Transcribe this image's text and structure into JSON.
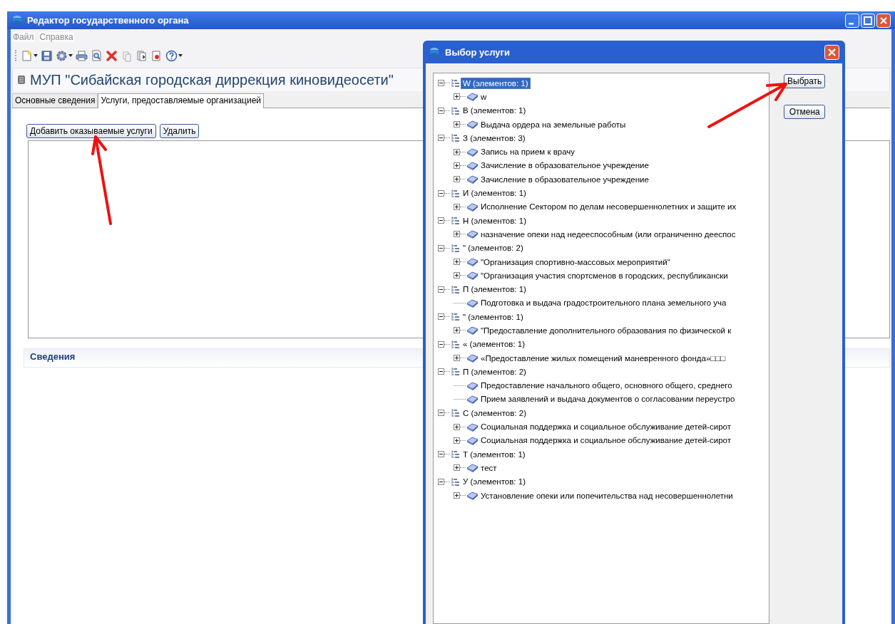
{
  "window": {
    "title": "Редактор государственного органа",
    "menu": [
      "Файл",
      "Справка"
    ]
  },
  "header": {
    "title": "МУП \"Сибайская городская диррекция киновидеосети\""
  },
  "tabs": [
    {
      "label": "Основные сведения",
      "selected": false
    },
    {
      "label": "Услуги, предоставляемые организацией",
      "selected": true
    }
  ],
  "actions": [
    "Добавить оказываемые услуги",
    "Удалить"
  ],
  "details_panel": {
    "title": "Сведения"
  },
  "dialog": {
    "title": "Выбор услуги",
    "buttons": [
      "Выбрать",
      "Отмена"
    ],
    "tree": [
      {
        "label": "W (элементов: 1)",
        "expanded": true,
        "selected": true,
        "children": [
          {
            "label": "w",
            "expandable": true,
            "selected": false
          }
        ]
      },
      {
        "label": "В (элементов: 1)",
        "expanded": true,
        "selected": false,
        "children": [
          {
            "label": "Выдача ордера на земельные работы",
            "expandable": true,
            "selected": false
          }
        ]
      },
      {
        "label": "З (элементов: 3)",
        "expanded": true,
        "selected": false,
        "children": [
          {
            "label": "Запись на прием к врачу",
            "expandable": true,
            "selected": false
          },
          {
            "label": "Зачисление в образовательное учреждение",
            "expandable": true,
            "selected": false
          },
          {
            "label": "Зачисление в образовательное учреждение",
            "expandable": true,
            "selected": false
          }
        ]
      },
      {
        "label": "И (элементов: 1)",
        "expanded": true,
        "selected": false,
        "children": [
          {
            "label": "Исполнение Сектором по делам несовершеннолетних и защите их",
            "expandable": true,
            "selected": false
          }
        ]
      },
      {
        "label": "Н (элементов: 1)",
        "expanded": true,
        "selected": false,
        "children": [
          {
            "label": "назначение опеки над недееспособным (или ограниченно дееспос",
            "expandable": true,
            "selected": false
          }
        ]
      },
      {
        "label": "\" (элементов: 2)",
        "expanded": true,
        "selected": false,
        "children": [
          {
            "label": "\"Организация спортивно-массовых мероприятий\"",
            "expandable": true,
            "selected": false
          },
          {
            "label": "\"Организация участия спортсменов в городских, республикански",
            "expandable": true,
            "selected": false
          }
        ]
      },
      {
        "label": "П (элементов: 1)",
        "expanded": true,
        "selected": false,
        "children": [
          {
            "label": "Подготовка и выдача градостроительного плана земельного уча",
            "expandable": false,
            "selected": false
          }
        ]
      },
      {
        "label": "\" (элементов: 1)",
        "expanded": true,
        "selected": false,
        "children": [
          {
            "label": "\"Предоставление дополнительного образования  по физической к",
            "expandable": true,
            "selected": false
          }
        ]
      },
      {
        "label": "« (элементов: 1)",
        "expanded": true,
        "selected": false,
        "children": [
          {
            "label": "«Предоставление жилых помещений маневренного фонда»□□□",
            "expandable": true,
            "selected": false
          }
        ]
      },
      {
        "label": "П (элементов: 2)",
        "expanded": true,
        "selected": false,
        "children": [
          {
            "label": "Предоставление начального общего, основного общего, среднего",
            "expandable": false,
            "selected": false
          },
          {
            "label": "Прием заявлений и выдача документов о согласовании переустро",
            "expandable": false,
            "selected": false
          }
        ]
      },
      {
        "label": "С (элементов: 2)",
        "expanded": true,
        "selected": false,
        "children": [
          {
            "label": "Социальная поддержка и социальное обслуживание детей-сирот",
            "expandable": true,
            "selected": false
          },
          {
            "label": "Социальная поддержка и социальное обслуживание детей-сирот",
            "expandable": true,
            "selected": false
          }
        ]
      },
      {
        "label": "Т (элементов: 1)",
        "expanded": true,
        "selected": false,
        "children": [
          {
            "label": "тест",
            "expandable": true,
            "selected": false
          }
        ]
      },
      {
        "label": "У (элементов: 1)",
        "expanded": true,
        "selected": false,
        "children": [
          {
            "label": "Установление опеки или попечительства над несовершеннолетни",
            "expandable": true,
            "selected": false
          }
        ]
      }
    ]
  }
}
